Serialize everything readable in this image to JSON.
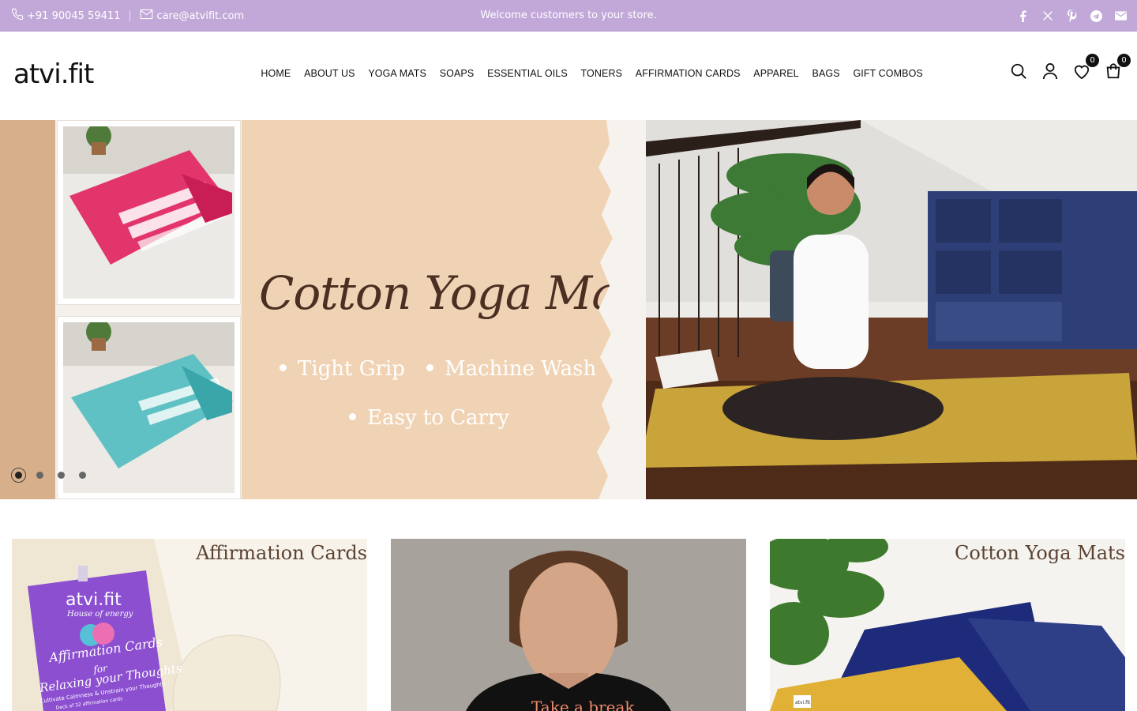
{
  "topbar": {
    "phone": "+91 90045 59411",
    "email": "care@atvifit.com",
    "welcome": "Welcome customers to your store.",
    "social_icons": [
      "facebook-icon",
      "x-icon",
      "pinterest-icon",
      "telegram-icon",
      "mail-icon"
    ],
    "background": "#c1a8d8"
  },
  "header": {
    "logo": "atvi.fit",
    "nav": [
      "HOME",
      "ABOUT US",
      "YOGA MATS",
      "SOAPS",
      "ESSENTIAL OILS",
      "TONERS",
      "AFFIRMATION CARDS",
      "APPAREL",
      "BAGS",
      "GIFT COMBOS"
    ],
    "wishlist_count": "0",
    "cart_count": "0"
  },
  "hero": {
    "headline": "Cotton Yoga Mats",
    "bullets": [
      "Tight Grip",
      "Machine Wash",
      "Easy to Carry"
    ],
    "slides_total": 4,
    "active_slide": 1,
    "colors": {
      "panel": "#f0d3b4",
      "headline": "#4a2f22"
    }
  },
  "categories": [
    {
      "title": "Affirmation Cards",
      "card_text": [
        "atvi.fit",
        "House of energy",
        "Affirmation Cards",
        "for",
        "Relaxing your Thoughts",
        "Cultivate Calmness & Unstrain your Thoughts",
        "Deck of 32 affirmation cards"
      ]
    },
    {
      "title": "",
      "shirt_text": "Take a break"
    },
    {
      "title": "Cotton Yoga Mats",
      "label": "atvi.fit"
    }
  ]
}
